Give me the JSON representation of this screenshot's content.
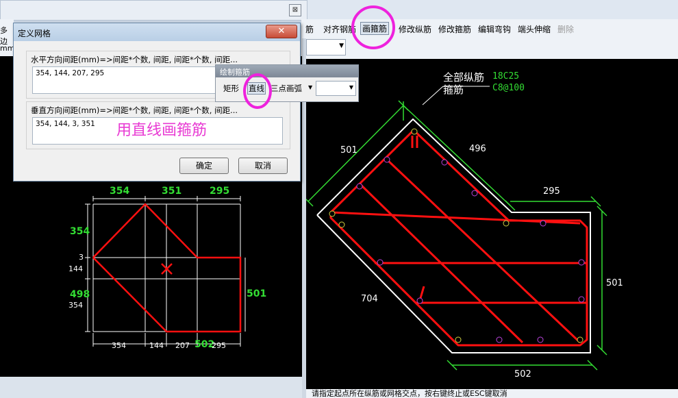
{
  "left_strip": {
    "text1": "多边",
    "text2": "mm"
  },
  "toolbar": {
    "items": [
      "筋",
      "对齐钢筋",
      "画箍筋",
      "修改纵筋",
      "修改箍筋",
      "编辑弯钩",
      "端头伸缩",
      "删除"
    ]
  },
  "dialog": {
    "title": "定义网格",
    "close_symbol": "✕",
    "horizontal_label": "水平方向间距(mm)=>间距*个数, 间距, 间距*个数, 间距...",
    "horizontal_value": "354, 144, 207, 295",
    "vertical_label": "垂直方向间距(mm)=>间距*个数, 间距, 间距*个数, 间距...",
    "vertical_value": "354, 144, 3, 351",
    "ok": "确定",
    "cancel": "取消"
  },
  "draw_panel": {
    "title": "绘制箍筋",
    "rect": "矩形",
    "line": "直线",
    "arc": "三点画弧"
  },
  "annotation": "用直线画箍筋",
  "left_drawing": {
    "top_dims": [
      "354",
      "351",
      "295"
    ],
    "bottom_dims": [
      "354",
      "144",
      "207",
      "502",
      "295"
    ],
    "left_labels": [
      "354",
      "3",
      "144",
      "498",
      "354"
    ],
    "right_dim": "501"
  },
  "right_drawing": {
    "label_all_bars": "全部纵筋",
    "label_stirrup": "箍筋",
    "all_bars_value": "18C25",
    "stirrup_value": "C8@100",
    "dims": [
      "501",
      "496",
      "295",
      "501",
      "704",
      "502"
    ]
  },
  "status": "请指定起点所在纵筋或网格交点，按右键终止或ESC键取消",
  "colors": {
    "green": "#33dd33",
    "red": "#ff1010",
    "magenta": "#ee22dd",
    "white": "#ffffff"
  }
}
